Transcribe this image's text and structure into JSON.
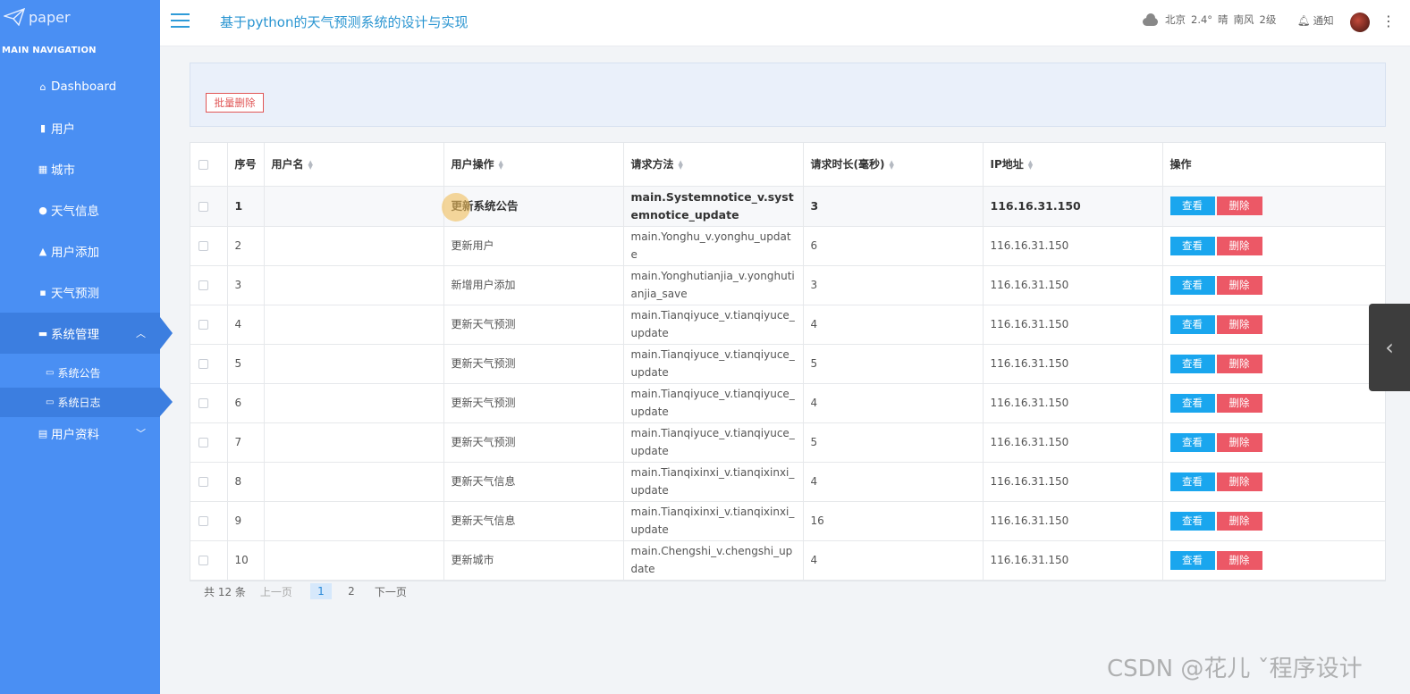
{
  "brand": {
    "name": "paper"
  },
  "nav": {
    "heading": "MAIN NAVIGATION",
    "items": [
      {
        "label": "Dashboard",
        "icon": "home-icon"
      },
      {
        "label": "用户",
        "icon": "bar-chart-icon"
      },
      {
        "label": "城市",
        "icon": "grid-icon"
      },
      {
        "label": "天气信息",
        "icon": "user-icon"
      },
      {
        "label": "用户添加",
        "icon": "user-add-icon"
      },
      {
        "label": "天气预测",
        "icon": "comment-icon"
      },
      {
        "label": "系统管理",
        "icon": "briefcase-icon"
      },
      {
        "label": "用户资料",
        "icon": "calendar-icon"
      }
    ],
    "sub_items": [
      {
        "label": "系统公告",
        "icon": "folder-icon"
      },
      {
        "label": "系统日志",
        "icon": "folder-icon"
      }
    ]
  },
  "header": {
    "title": "基于python的天气预测系统的设计与实现",
    "weather": {
      "city": "北京",
      "temp": "2.4°",
      "condition": "晴",
      "wind": "南风",
      "level": "2级"
    },
    "notify_label": "通知"
  },
  "actions": {
    "batch_delete": "批量删除"
  },
  "table": {
    "columns": [
      "序号",
      "用户名",
      "用户操作",
      "请求方法",
      "请求时长(毫秒)",
      "IP地址",
      "操作"
    ],
    "view_label": "查看",
    "delete_label": "删除",
    "rows": [
      {
        "no": "1",
        "user": "",
        "op": "更新系统公告",
        "method": "main.Systemnotice_v.systemnotice_update",
        "duration": "3",
        "ip": "116.16.31.150"
      },
      {
        "no": "2",
        "user": "",
        "op": "更新用户",
        "method": "main.Yonghu_v.yonghu_update",
        "duration": "6",
        "ip": "116.16.31.150"
      },
      {
        "no": "3",
        "user": "",
        "op": "新增用户添加",
        "method": "main.Yonghutianjia_v.yonghutianjia_save",
        "duration": "3",
        "ip": "116.16.31.150"
      },
      {
        "no": "4",
        "user": "",
        "op": "更新天气预测",
        "method": "main.Tianqiyuce_v.tianqiyuce_update",
        "duration": "4",
        "ip": "116.16.31.150"
      },
      {
        "no": "5",
        "user": "",
        "op": "更新天气预测",
        "method": "main.Tianqiyuce_v.tianqiyuce_update",
        "duration": "5",
        "ip": "116.16.31.150"
      },
      {
        "no": "6",
        "user": "",
        "op": "更新天气预测",
        "method": "main.Tianqiyuce_v.tianqiyuce_update",
        "duration": "4",
        "ip": "116.16.31.150"
      },
      {
        "no": "7",
        "user": "",
        "op": "更新天气预测",
        "method": "main.Tianqiyuce_v.tianqiyuce_update",
        "duration": "5",
        "ip": "116.16.31.150"
      },
      {
        "no": "8",
        "user": "",
        "op": "更新天气信息",
        "method": "main.Tianqixinxi_v.tianqixinxi_update",
        "duration": "4",
        "ip": "116.16.31.150"
      },
      {
        "no": "9",
        "user": "",
        "op": "更新天气信息",
        "method": "main.Tianqixinxi_v.tianqixinxi_update",
        "duration": "16",
        "ip": "116.16.31.150"
      },
      {
        "no": "10",
        "user": "",
        "op": "更新城市",
        "method": "main.Chengshi_v.chengshi_update",
        "duration": "4",
        "ip": "116.16.31.150"
      }
    ]
  },
  "pagination": {
    "total": "共 12 条",
    "prev": "上一页",
    "pages": [
      "1",
      "2"
    ],
    "current": "1",
    "next": "下一页"
  },
  "watermark": "CSDN @花儿 ˇ程序设计",
  "colors": {
    "sidebar": "#4a8ff3",
    "sidebar_active": "#3c7ee0",
    "title": "#2a95d1",
    "view_btn": "#1aa6ee",
    "delete_btn": "#ec5866"
  }
}
